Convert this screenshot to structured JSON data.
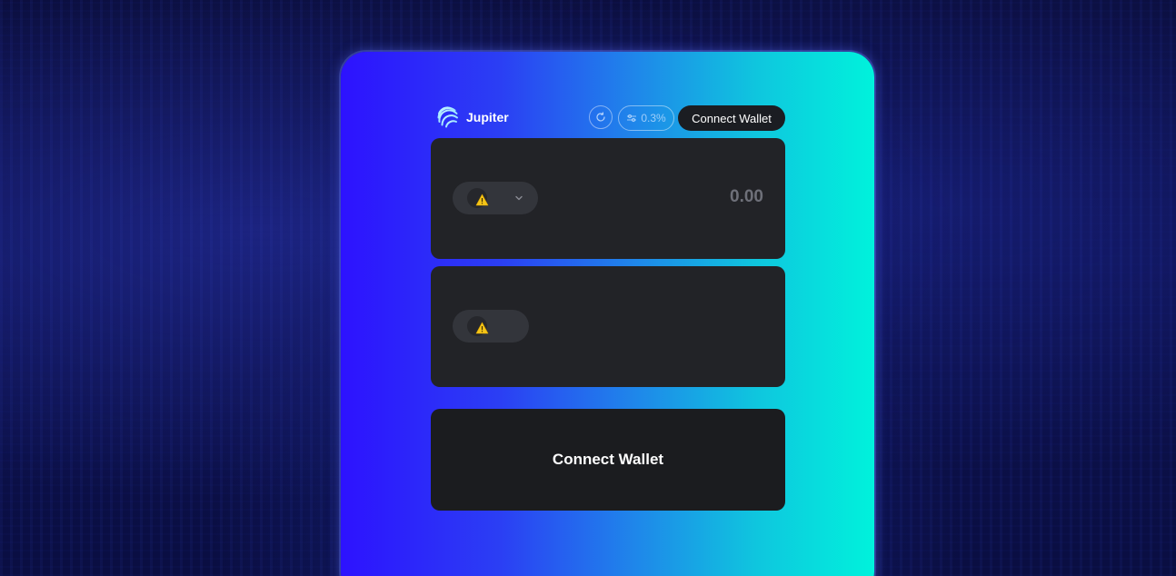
{
  "header": {
    "brand_name": "Jupiter",
    "slippage_label": "0.3%",
    "connect_label": "Connect Wallet"
  },
  "swap": {
    "from": {
      "amount_placeholder": "0.00",
      "token_icon": "warning-icon"
    },
    "to": {
      "token_icon": "warning-icon"
    }
  },
  "main_action": {
    "label": "Connect Wallet"
  },
  "colors": {
    "gradient_start": "#2d12ff",
    "gradient_end": "#00f2dc",
    "panel_bg": "#222327",
    "button_bg": "#1b1c1f",
    "warning": "#f5c518"
  }
}
